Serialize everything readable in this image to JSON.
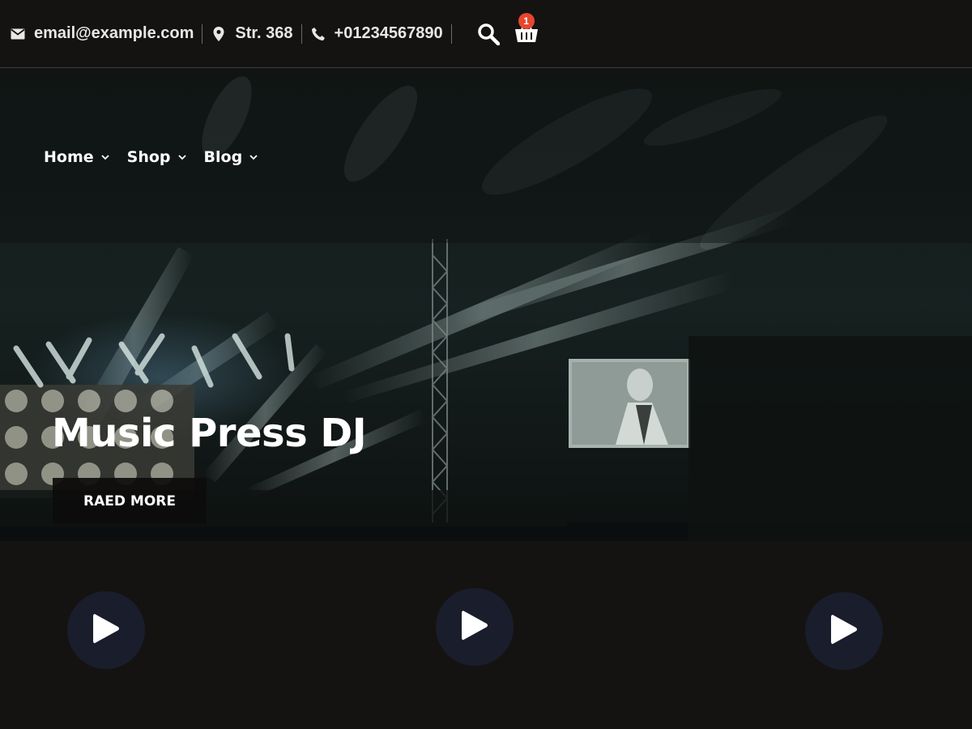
{
  "topbar": {
    "email": {
      "icon": "envelope-icon",
      "text": "email@example.com"
    },
    "address": {
      "icon": "map-pin-icon",
      "text": "Str. 368"
    },
    "phone": {
      "icon": "phone-icon",
      "text": "+01234567890"
    },
    "search": {
      "icon": "search-icon"
    },
    "cart": {
      "icon": "basket-icon",
      "count": "1"
    }
  },
  "nav": {
    "items": [
      {
        "label": "Home",
        "icon": "chevron-down-icon"
      },
      {
        "label": "Shop",
        "icon": "chevron-down-icon"
      },
      {
        "label": "Blog",
        "icon": "chevron-down-icon"
      }
    ]
  },
  "hero": {
    "title": "Music Press DJ",
    "button_label": "RAED MORE"
  },
  "media": {
    "play_buttons": [
      {
        "icon": "play-icon"
      },
      {
        "icon": "play-icon"
      },
      {
        "icon": "play-icon"
      }
    ]
  },
  "colors": {
    "background": "#141312",
    "badge": "#e8452f",
    "play_circle": "#1a1d2b",
    "text": "#ffffff"
  }
}
